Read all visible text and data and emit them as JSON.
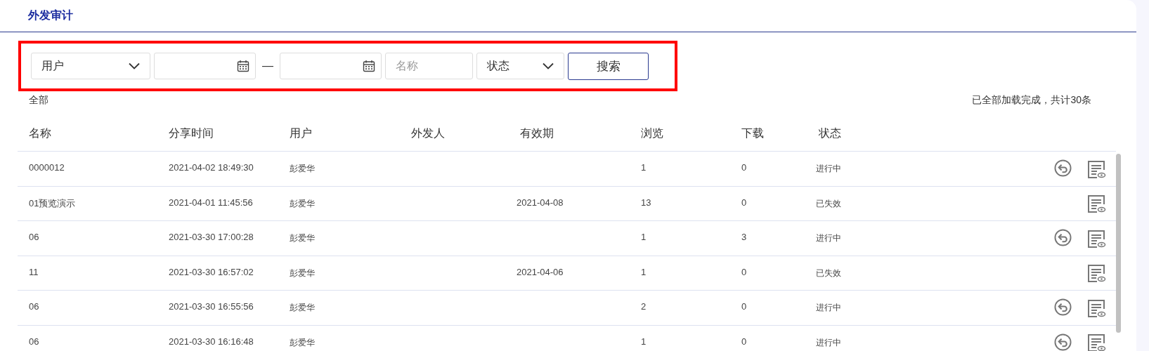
{
  "page_title": "外发审计",
  "filter_bar": {
    "highlighted": true,
    "user_select": {
      "value": "用户"
    },
    "date_separator": "—",
    "name_field": {
      "placeholder": "名称"
    },
    "status_select": {
      "value": "状态"
    },
    "search_button": "搜索"
  },
  "scope_label": "全部",
  "load_status": "已全部加载完成，共计30条",
  "table": {
    "columns": [
      "名称",
      "分享时间",
      "用户",
      "外发人",
      "有效期",
      "浏览",
      "下载",
      "状态"
    ],
    "rows": [
      {
        "cells": [
          "0000012",
          "2021-04-02 18:49:30",
          "彭爱华",
          "",
          "",
          "1",
          "0",
          "进行中"
        ],
        "revocable": true
      },
      {
        "cells": [
          "01预览演示",
          "2021-04-01 11:45:56",
          "彭爱华",
          "",
          "2021-04-08",
          "13",
          "0",
          "已失效"
        ],
        "revocable": false
      },
      {
        "cells": [
          "06",
          "2021-03-30 17:00:28",
          "彭爱华",
          "",
          "",
          "1",
          "3",
          "进行中"
        ],
        "revocable": true
      },
      {
        "cells": [
          "11",
          "2021-03-30 16:57:02",
          "彭爱华",
          "",
          "2021-04-06",
          "1",
          "0",
          "已失效"
        ],
        "revocable": false
      },
      {
        "cells": [
          "06",
          "2021-03-30 16:55:56",
          "彭爱华",
          "",
          "",
          "2",
          "0",
          "进行中"
        ],
        "revocable": true
      },
      {
        "cells": [
          "06",
          "2021-03-30 16:16:48",
          "彭爱华",
          "",
          "",
          "1",
          "0",
          "进行中"
        ],
        "revocable": true
      }
    ]
  }
}
